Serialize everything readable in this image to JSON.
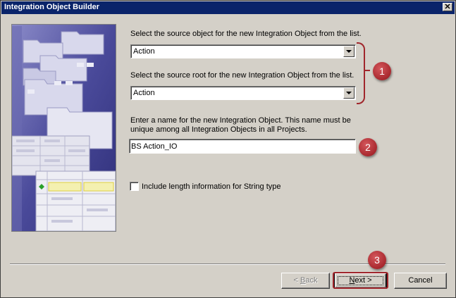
{
  "window": {
    "title": "Integration Object Builder",
    "close_glyph": "✕"
  },
  "form": {
    "source_object_label": "Select the source object for the new Integration Object from the list.",
    "source_object_value": "Action",
    "source_root_label": "Select the source root for the new Integration Object from the list.",
    "source_root_value": "Action",
    "name_label_line1": "Enter a name for the new Integration Object. This name must be",
    "name_label_line2": "unique among all Integration Objects in all Projects.",
    "name_value": "BS Action_IO",
    "include_length_label": "Include length information for String type",
    "include_length_checked": false
  },
  "callouts": {
    "one": "1",
    "two": "2",
    "three": "3",
    "color": "#a0262c"
  },
  "buttons": {
    "back_prefix": "< ",
    "back_mnemonic": "B",
    "back_rest": "ack",
    "next_mnemonic": "N",
    "next_rest": "ext >",
    "cancel": "Cancel"
  },
  "colors": {
    "titlebar": "#0a246a",
    "face": "#d4d0c8",
    "art_bg": "#3c3c8c"
  }
}
